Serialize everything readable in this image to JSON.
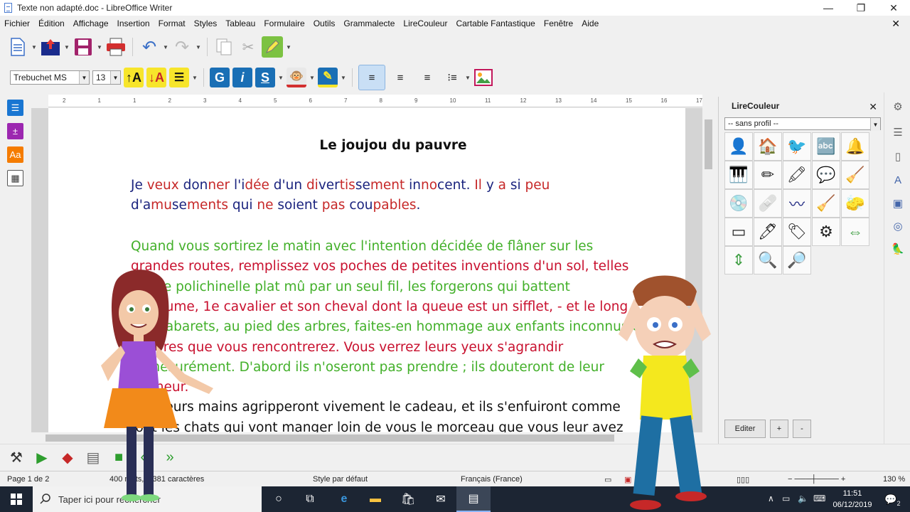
{
  "window": {
    "title": "Texte non adapté.doc - LibreOffice Writer",
    "minimize": "—",
    "maximize": "❐",
    "close": "✕",
    "close_doc": "✕"
  },
  "menu": [
    "Fichier",
    "Édition",
    "Affichage",
    "Insertion",
    "Format",
    "Styles",
    "Tableau",
    "Formulaire",
    "Outils",
    "Grammalecte",
    "LireCouleur",
    "Cartable Fantastique",
    "Fenêtre",
    "Aide"
  ],
  "toolbar": {
    "font_name": "Trebuchet MS",
    "font_size": "13"
  },
  "ruler": {
    "ticks": [
      "2",
      "1",
      "1",
      "2",
      "3",
      "4",
      "5",
      "6",
      "7",
      "8",
      "9",
      "10",
      "11",
      "12",
      "13",
      "14",
      "15",
      "16",
      "17"
    ]
  },
  "document": {
    "heading": "Le joujou du pauvre",
    "para1_line1": [
      {
        "t": "Je ",
        "c": "#1a237e"
      },
      {
        "t": "veux ",
        "c": "#c62828"
      },
      {
        "t": "don",
        "c": "#1a237e"
      },
      {
        "t": "ner ",
        "c": "#c62828"
      },
      {
        "t": "l'i",
        "c": "#1a237e"
      },
      {
        "t": "dée ",
        "c": "#c62828"
      },
      {
        "t": "d'un ",
        "c": "#1a237e"
      },
      {
        "t": "di",
        "c": "#c62828"
      },
      {
        "t": "ver",
        "c": "#1a237e"
      },
      {
        "t": "tis",
        "c": "#c62828"
      },
      {
        "t": "se",
        "c": "#1a237e"
      },
      {
        "t": "ment ",
        "c": "#c62828"
      },
      {
        "t": "in",
        "c": "#1a237e"
      },
      {
        "t": "no",
        "c": "#c62828"
      },
      {
        "t": "cent. ",
        "c": "#1a237e"
      },
      {
        "t": "Il ",
        "c": "#c62828"
      },
      {
        "t": "y ",
        "c": "#1a237e"
      },
      {
        "t": "a ",
        "c": "#c62828"
      },
      {
        "t": "si ",
        "c": "#1a237e"
      },
      {
        "t": "peu",
        "c": "#c62828"
      }
    ],
    "para1_line2": [
      {
        "t": "d'a",
        "c": "#1a237e"
      },
      {
        "t": "mu",
        "c": "#c62828"
      },
      {
        "t": "se",
        "c": "#1a237e"
      },
      {
        "t": "ments ",
        "c": "#c62828"
      },
      {
        "t": "qui ",
        "c": "#1a237e"
      },
      {
        "t": "ne ",
        "c": "#c62828"
      },
      {
        "t": "soient ",
        "c": "#1a237e"
      },
      {
        "t": "pas ",
        "c": "#c62828"
      },
      {
        "t": "cou",
        "c": "#1a237e"
      },
      {
        "t": "pables",
        "c": "#c62828"
      },
      {
        "t": ".",
        "c": "#1a237e"
      }
    ],
    "para2_lines": [
      {
        "t": "Quand vous sortirez le matin avec l'intention décidée de flâner sur les",
        "c": "#43b02a"
      },
      {
        "t": "grandes routes, remplissez vos poches de petites inventions d'un sol, telles",
        "c": "#c8102e"
      },
      {
        "t": "que le polichinelle plat mû par un seul fil, les forgerons qui battent",
        "c": "#43b02a"
      },
      {
        "t": "l'enclume, 1e cavalier et son cheval dont la queue est un sifflet, - et le long",
        "c": "#c8102e"
      },
      {
        "t": "des cabarets, au pied des arbres, faites-en hommage aux enfants inconnus et",
        "c": "#43b02a"
      },
      {
        "t": "pauvres que vous rencontrerez. Vous verrez leurs yeux s'agrandir",
        "c": "#c8102e"
      },
      {
        "t": "démesurément. D'abord ils n'oseront pas prendre ; ils douteront de leur",
        "c": "#43b02a"
      },
      {
        "t": "bonheur.",
        "c": "#c8102e"
      },
      {
        "t": "Puis leurs mains agripperont vivement le cadeau, et ils s'enfuiront comme",
        "c": "#111111"
      },
      {
        "t": "font les chats qui vont manger loin de vous le morceau que vous leur avez",
        "c": "#111111"
      }
    ]
  },
  "sidebar": {
    "title": "LireCouleur",
    "profile": "-- sans profil --",
    "edit_button": "Editer",
    "plus_button": "+",
    "minus_button": "-"
  },
  "statusbar": {
    "page": "Page 1 de 2",
    "words": "400 mots, 2 381 caractères",
    "style": "Style par défaut",
    "language": "Français (France)",
    "zoom": "130 %"
  },
  "taskbar": {
    "search_placeholder": "Taper ici pour rechercher",
    "time": "11:51",
    "date": "06/12/2019",
    "notifications": "2"
  }
}
